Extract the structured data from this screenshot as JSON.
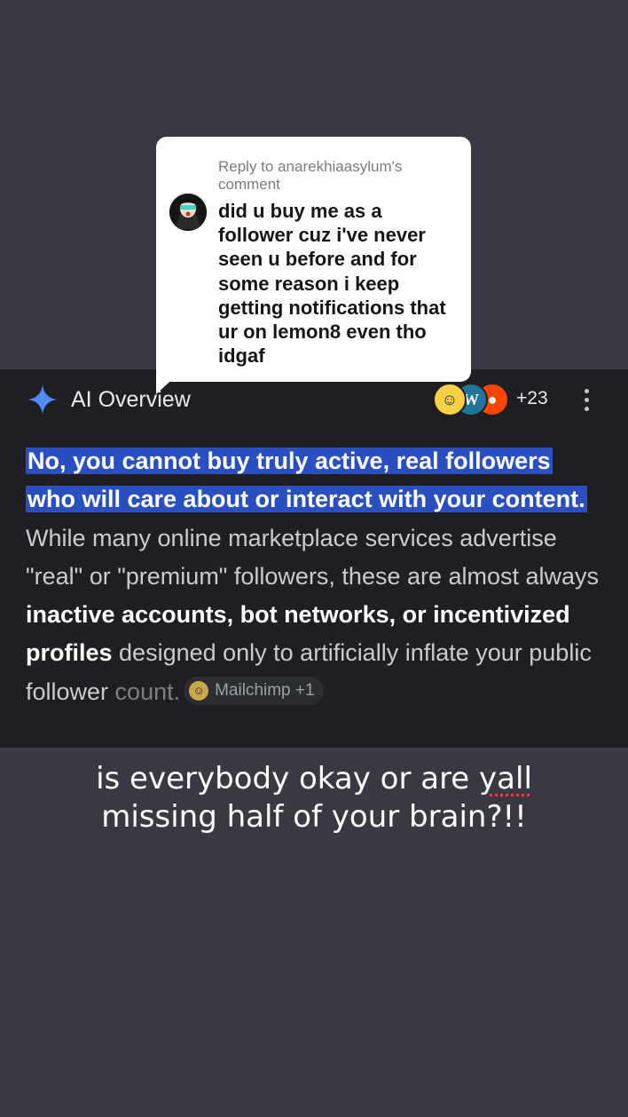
{
  "reply_bubble": {
    "reply_label": "Reply to anarekhiaasylum's comment",
    "comment_text": "did u buy me as a follower cuz i've never seen u before and for some reason i keep getting notifications that ur on lemon8 even tho idgaf"
  },
  "ai_overview": {
    "title": "AI Overview",
    "source_count": "+23",
    "highlighted_text": "No, you cannot buy truly active, real followers who will care about or interact with your content.",
    "text_part1": " While many online marketplace services advertise \"real\" or \"premium\" followers, these are almost always ",
    "bold_text": "inactive accounts, bot networks, or incentivized profiles",
    "text_part2": " designed only to artificially inflate your public follower ",
    "faded_word": "count.",
    "citation_chip": {
      "label": "Mailchimp +1",
      "icon": "mailchimp-icon"
    },
    "source_icons": [
      "mailchimp-icon",
      "wordpress-icon",
      "reddit-icon"
    ]
  },
  "caption": {
    "line1_part1": "is everybody okay or are ",
    "line1_flagged_word": "yall",
    "line2": "missing half of your brain?!!"
  },
  "colors": {
    "background": "#393843",
    "panel": "#1f1f23",
    "highlight": "#2a4fc1",
    "spark": "#4f8cf5"
  }
}
